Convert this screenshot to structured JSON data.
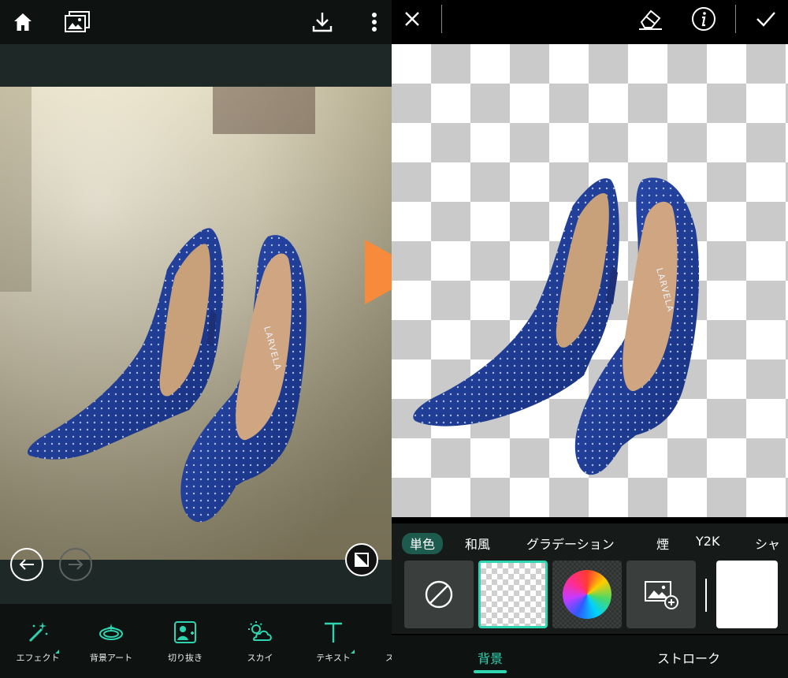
{
  "left_panel": {
    "tools": [
      {
        "icon": "magic-wand-icon",
        "label": "エフェクト"
      },
      {
        "icon": "background-art-icon",
        "label": "背景アート"
      },
      {
        "icon": "cutout-icon",
        "label": "切り抜き"
      },
      {
        "icon": "sky-icon",
        "label": "スカイ"
      },
      {
        "icon": "text-icon",
        "label": "テキスト"
      },
      {
        "icon": "partial-tool-icon",
        "label": "ス"
      }
    ],
    "accent_color": "#2fd5b0"
  },
  "right_panel": {
    "category_tabs": [
      "単色",
      "和風",
      "グラデーション",
      "煙",
      "Y2K",
      "シャ"
    ],
    "selected_category": "単色",
    "bottom_tabs": [
      "背景",
      "ストローク"
    ],
    "selected_bottom_tab": "背景",
    "accent_color": "#2fd5b0"
  },
  "brand_text": "LARVELA",
  "arrow_color": "#f78b3b"
}
